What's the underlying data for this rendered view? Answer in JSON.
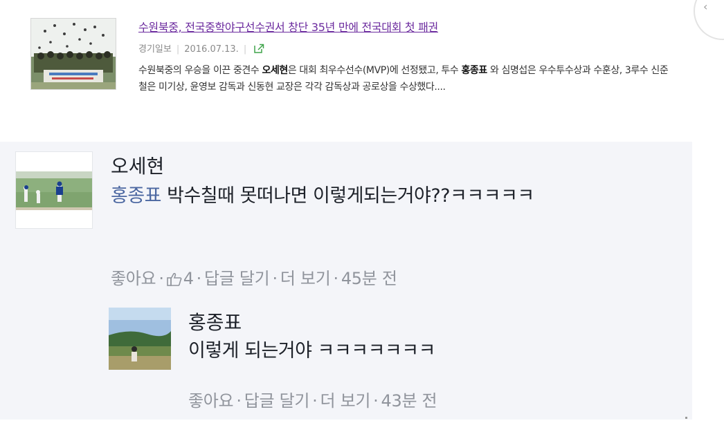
{
  "news": {
    "title": "수원북중, 전국중학야구선수권서 창단 35년 만에 전국대회 첫 패권",
    "source": "경기일보",
    "date": "2016.07.13.",
    "body_html": "수원북중의 우승을 이끈 중견수 <b>오세현</b>은 대회 최우수선수(MVP)에 선정됐고, 투수 <b>홍종표</b> 와 심명섭은 우수투수상과 수훈상, 3루수 신준철은 미기상, 윤영보 감독과 신동현 교장은 각각 감독상과 공로상을 수상했다...."
  },
  "comments": [
    {
      "author": "오세현",
      "mention": "홍종표",
      "text": "박수칠때 못떠나면 이렇게되는거야??ㅋㅋㅋㅋㅋ",
      "actions": {
        "like": "좋아요",
        "like_count": "4",
        "reply": "답글 달기",
        "more": "더 보기",
        "time": "45분 전"
      }
    },
    {
      "author": "홍종표",
      "text": "이렇게 되는거야 ㅋㅋㅋㅋㅋㅋㅋ",
      "actions": {
        "like": "좋아요",
        "reply": "답글 달기",
        "more": "더 보기",
        "time": "43분 전"
      }
    }
  ],
  "colors": {
    "link_title": "#6b2a9e",
    "mention": "#4b67a1",
    "action_text": "#90949c",
    "comment_bg": "#f4f5f9"
  },
  "icons": {
    "share": "share-icon",
    "like": "thumbs-up-icon"
  }
}
